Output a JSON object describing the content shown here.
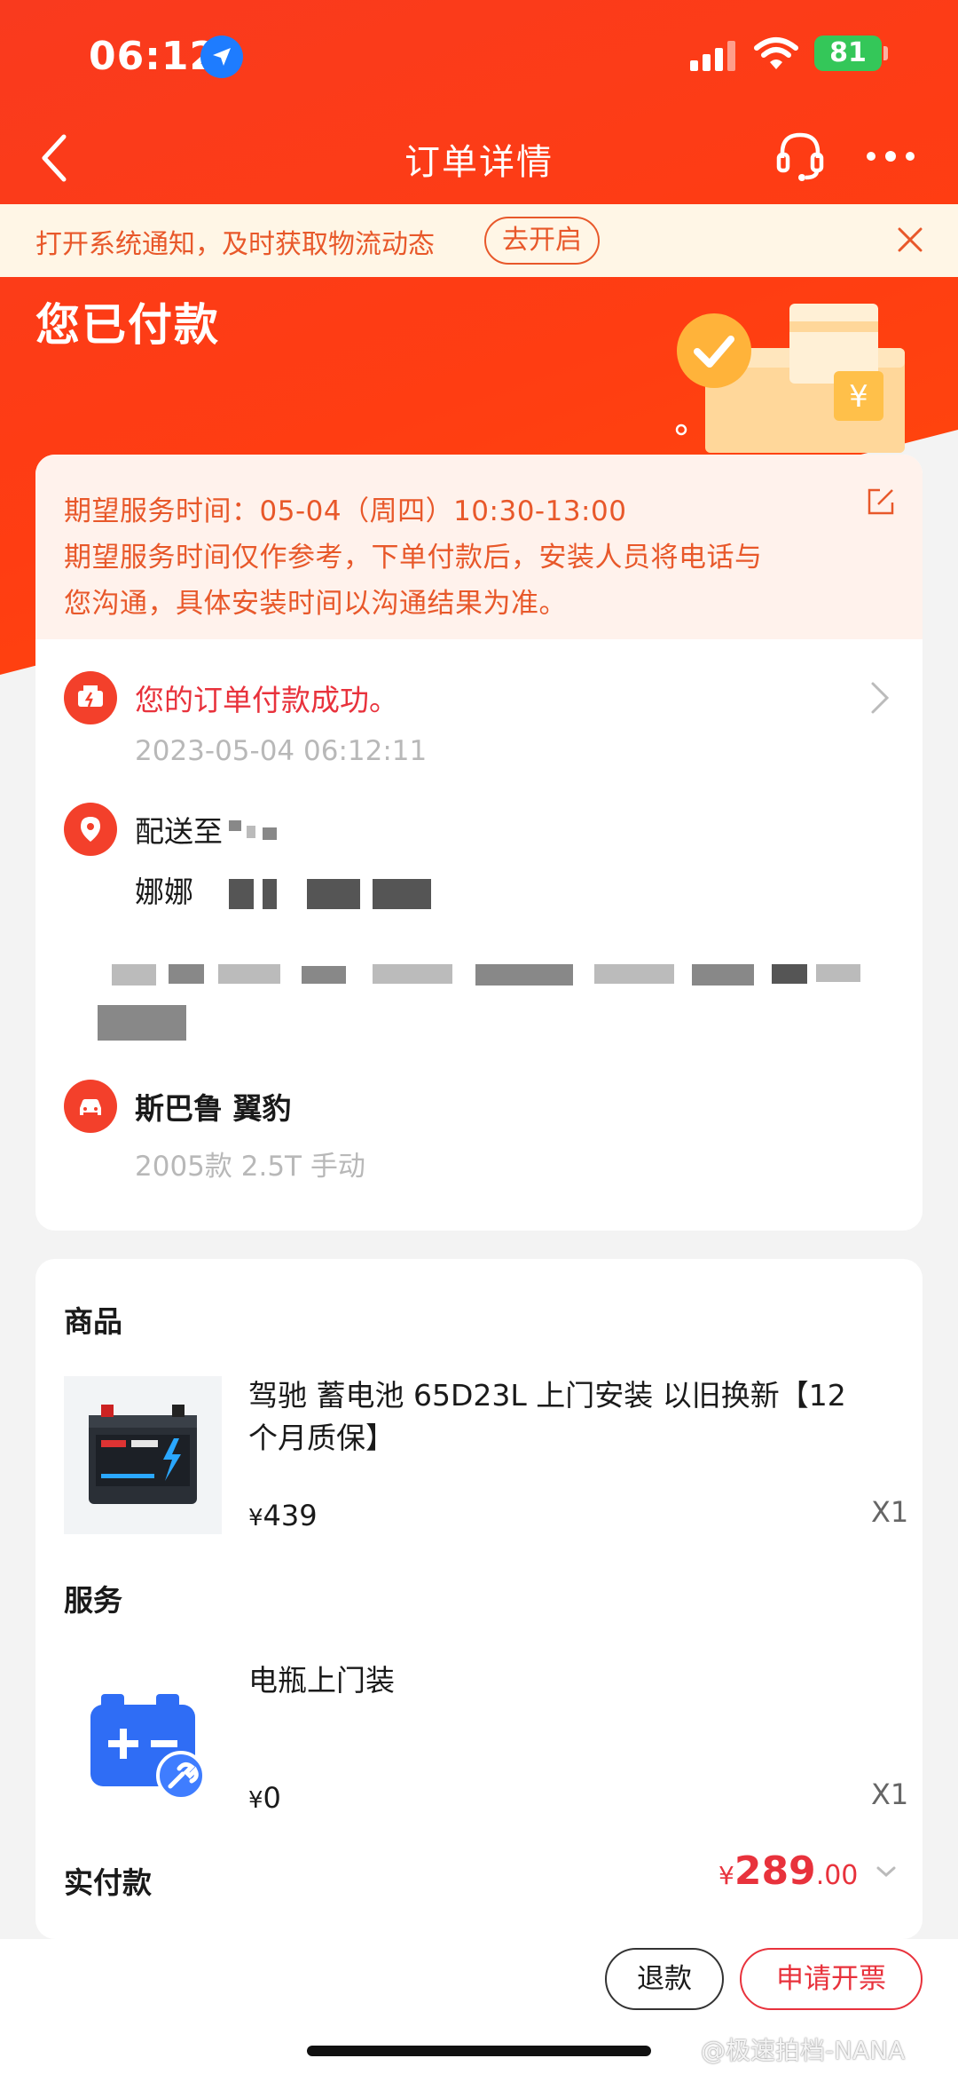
{
  "status_bar": {
    "time": "06:12",
    "battery": "81"
  },
  "nav": {
    "title": "订单详情"
  },
  "notify": {
    "text": "打开系统通知，及时获取物流动态",
    "button": "去开启"
  },
  "hero": {
    "title": "您已付款"
  },
  "expect": {
    "line1": "期望服务时间：05-04（周四）10:30-13:00",
    "line2": "期望服务时间仅作参考，下单付款后，安装人员将电话与",
    "line3": "您沟通，具体安装时间以沟通结果为准。"
  },
  "status": {
    "text": "您的订单付款成功。",
    "time": "2023-05-04 06:12:11"
  },
  "shipping": {
    "label": "配送至",
    "name": "娜娜"
  },
  "car": {
    "name": "斯巴鲁 翼豹",
    "model": "2005款 2.5T 手动"
  },
  "products": {
    "heading": "商品",
    "name": "驾驰 蓄电池 65D23L 上门安装 以旧换新【12个月质保】",
    "currency": "¥",
    "price": "439",
    "qty": "X1"
  },
  "service": {
    "heading": "服务",
    "name": "电瓶上门装",
    "currency": "¥",
    "price": "0",
    "qty": "X1"
  },
  "payment": {
    "label": "实付款",
    "currency": "¥",
    "integer": "289",
    "decimal": ".00"
  },
  "actions": {
    "refund": "退款",
    "invoice": "申请开票"
  },
  "watermark": "@极速拍档-NANA",
  "colors": {
    "brand": "#f93a1e",
    "accent_red": "#e8323c",
    "orange": "#e8582a"
  }
}
